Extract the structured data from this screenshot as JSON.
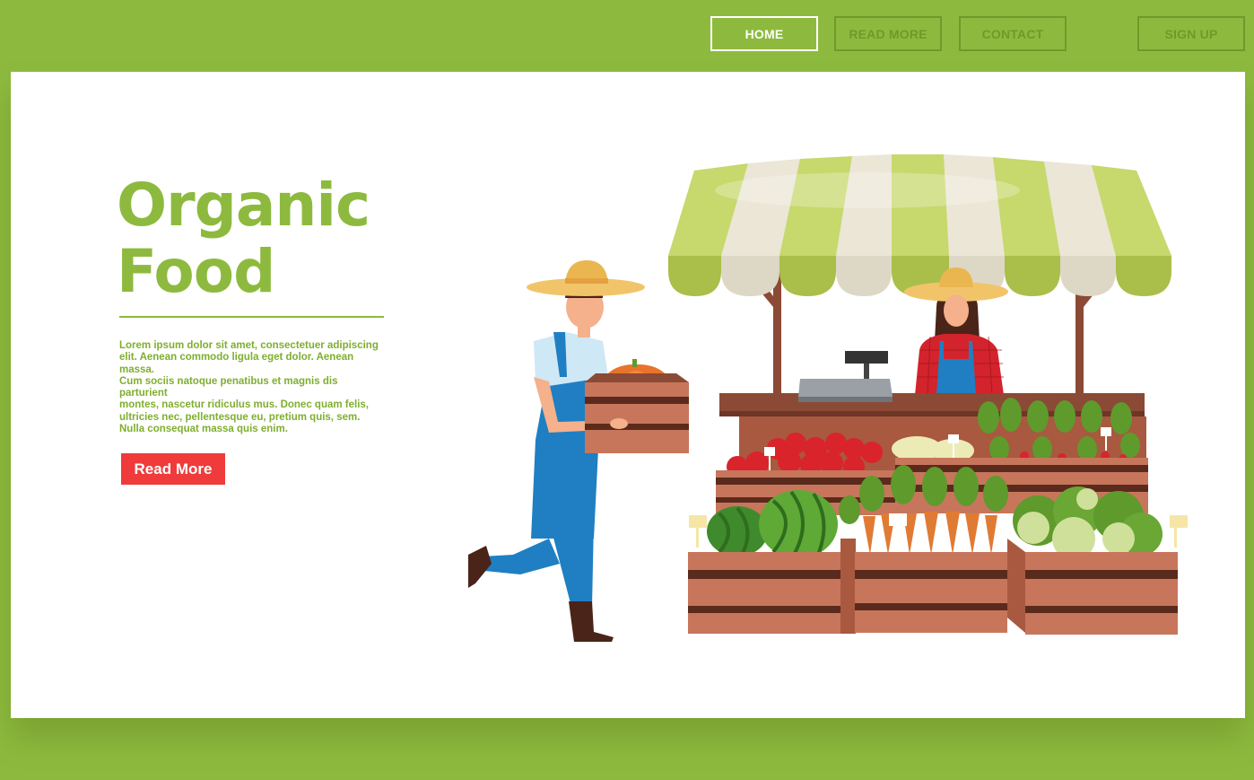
{
  "nav": {
    "home": "HOME",
    "read_more": "READ MORE",
    "contact": "CONTACT",
    "sign_up": "SIGN UP"
  },
  "hero": {
    "title_line1": "Organic",
    "title_line2": "Food",
    "body_lines": [
      "Lorem ipsum dolor sit amet, consectetuer adipiscing",
      "elit. Aenean commodo ligula eget dolor. Aenean massa.",
      "Cum sociis natoque penatibus et magnis dis parturient",
      "montes, nascetur ridiculus mus. Donec quam felis,",
      "ultricies nec, pellentesque eu, pretium quis, sem.",
      "Nulla consequat massa quis enim."
    ],
    "button_label": "Read More"
  },
  "colors": {
    "brand_green": "#8dba3e",
    "accent_red": "#ef3b3b",
    "panel": "#ffffff"
  }
}
